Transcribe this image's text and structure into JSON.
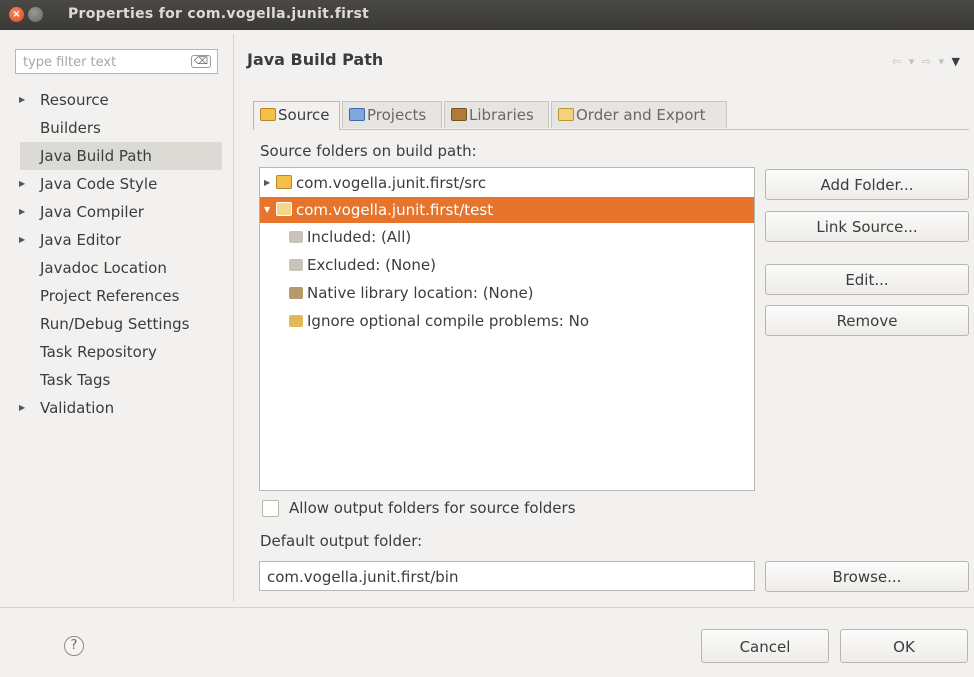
{
  "window": {
    "title": "Properties for com.vogella.junit.first",
    "close_glyph": "×"
  },
  "filter": {
    "placeholder": "type filter text",
    "clear_label": "⌫"
  },
  "nav": {
    "items": [
      {
        "label": "Resource",
        "expandable": true
      },
      {
        "label": "Builders",
        "expandable": false
      },
      {
        "label": "Java Build Path",
        "expandable": false,
        "selected": true
      },
      {
        "label": "Java Code Style",
        "expandable": true
      },
      {
        "label": "Java Compiler",
        "expandable": true
      },
      {
        "label": "Java Editor",
        "expandable": true
      },
      {
        "label": "Javadoc Location",
        "expandable": false
      },
      {
        "label": "Project References",
        "expandable": false
      },
      {
        "label": "Run/Debug Settings",
        "expandable": false
      },
      {
        "label": "Task Repository",
        "expandable": false
      },
      {
        "label": "Task Tags",
        "expandable": false
      },
      {
        "label": "Validation",
        "expandable": true
      }
    ]
  },
  "page": {
    "title": "Java Build Path",
    "history": {
      "back_icon": "⇦",
      "forward_icon": "⇨",
      "dropdown_icon": "▾",
      "menu_icon": "▼"
    }
  },
  "tabs": [
    {
      "label": "Source",
      "active": true
    },
    {
      "label": "Projects",
      "active": false
    },
    {
      "label": "Libraries",
      "active": false
    },
    {
      "label": "Order and Export",
      "active": false
    }
  ],
  "source": {
    "heading": "Source folders on build path:",
    "tree": [
      {
        "label": "com.vogella.junit.first/src",
        "level": 0,
        "expanded": false
      },
      {
        "label": "com.vogella.junit.first/test",
        "level": 0,
        "expanded": true,
        "selected": true
      },
      {
        "label": "Included: (All)",
        "level": 1
      },
      {
        "label": "Excluded: (None)",
        "level": 1
      },
      {
        "label": "Native library location: (None)",
        "level": 1
      },
      {
        "label": "Ignore optional compile problems: No",
        "level": 1
      }
    ],
    "buttons": {
      "add_folder": "Add Folder...",
      "link_source": "Link Source...",
      "edit": "Edit...",
      "remove": "Remove"
    },
    "allow_output_label": "Allow output folders for source folders",
    "allow_output_checked": false,
    "default_output_label": "Default output folder:",
    "default_output_value": "com.vogella.junit.first/bin",
    "browse_label": "Browse..."
  },
  "footer": {
    "help_glyph": "?",
    "cancel_label": "Cancel",
    "ok_label": "OK"
  },
  "colors": {
    "selection": "#e7742d",
    "titlebar": "#3c3b37",
    "window_bg": "#f2f1f0"
  }
}
